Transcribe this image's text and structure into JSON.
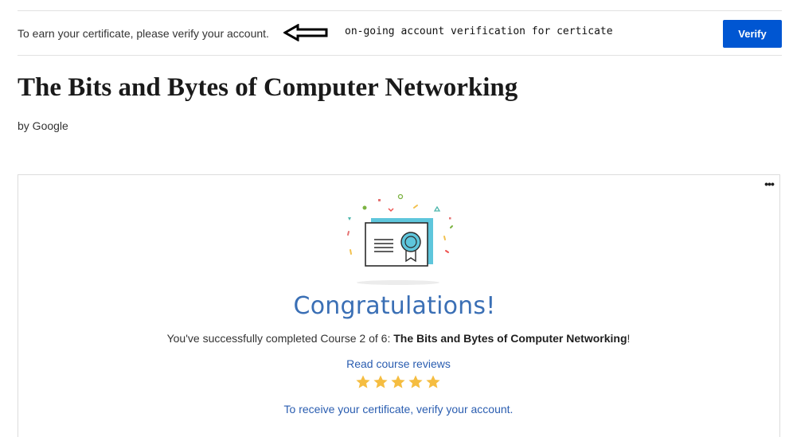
{
  "banner": {
    "message": "To earn your certificate, please verify your account.",
    "annotation": "on-going account verification for certicate",
    "verify_label": "Verify"
  },
  "course": {
    "title": "The Bits and Bytes of Computer Networking",
    "byline": "by Google"
  },
  "card": {
    "more_label": "•••",
    "heading": "Congratulations!",
    "completed_prefix": "You've successfully completed Course 2 of 6: ",
    "completed_course": "The Bits and Bytes of Computer Networking",
    "completed_suffix": "!",
    "reviews_link": "Read course reviews",
    "rating": 5,
    "rating_max": 5,
    "receive_link": "To receive your certificate, verify your account."
  },
  "colors": {
    "primary_button": "#0056d2",
    "heading_blue": "#3a6fb5",
    "link_blue": "#2a5db0",
    "star_gold": "#f5bd41"
  },
  "icons": {
    "arrow": "left-arrow-icon",
    "certificate": "certificate-icon",
    "star": "star-icon",
    "more": "more-options-icon"
  }
}
